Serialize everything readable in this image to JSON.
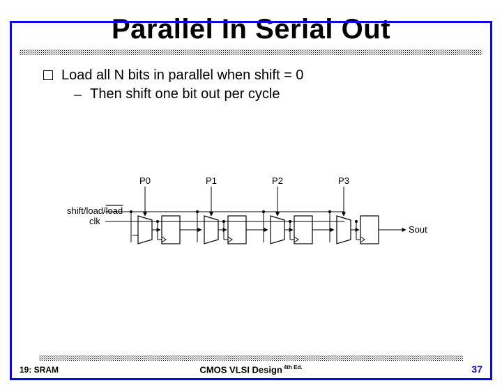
{
  "title": "Parallel In Serial Out",
  "bullets": {
    "b1": "Load all N bits in parallel when shift = 0",
    "b1a": "Then shift one bit out per cycle"
  },
  "diagram": {
    "inputs": [
      "P0",
      "P1",
      "P2",
      "P3"
    ],
    "shift_load_label": "shift/load",
    "clk_label": "clk",
    "sout_label": "Sout"
  },
  "footer": {
    "left": "19: SRAM",
    "center": "CMOS VLSI Design",
    "edition": "4th Ed.",
    "page": "37"
  }
}
